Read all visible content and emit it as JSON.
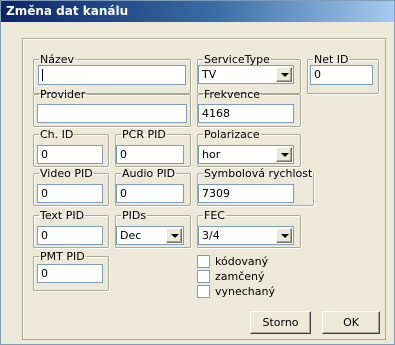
{
  "window": {
    "title": "Změna dat kanálu"
  },
  "fields": {
    "nazev": {
      "label": "Název",
      "value": ""
    },
    "service_type": {
      "label": "ServiceType",
      "value": "TV"
    },
    "net_id": {
      "label": "Net ID",
      "value": "0"
    },
    "provider": {
      "label": "Provider",
      "value": ""
    },
    "frekvence": {
      "label": "Frekvence",
      "value": "4168"
    },
    "ch_id": {
      "label": "Ch. ID",
      "value": "0"
    },
    "pcr_pid": {
      "label": "PCR PID",
      "value": "0"
    },
    "polarizace": {
      "label": "Polarizace",
      "value": "hor"
    },
    "video_pid": {
      "label": "Video PID",
      "value": "0"
    },
    "audio_pid": {
      "label": "Audio PID",
      "value": "0"
    },
    "symbolova_rychlost": {
      "label": "Symbolová rychlost",
      "value": "7309"
    },
    "text_pid": {
      "label": "Text PID",
      "value": "0"
    },
    "pids": {
      "label": "PIDs",
      "value": "Dec"
    },
    "fec": {
      "label": "FEC",
      "value": "3/4"
    },
    "pmt_pid": {
      "label": "PMT PID",
      "value": "0"
    }
  },
  "checkboxes": [
    {
      "label": "kódovaný",
      "checked": false
    },
    {
      "label": "zamčený",
      "checked": false
    },
    {
      "label": "vynechaný",
      "checked": false
    }
  ],
  "buttons": {
    "cancel": "Storno",
    "ok": "OK"
  },
  "colors": {
    "face": "#ece9d8",
    "titlebar_start": "#0a246a",
    "titlebar_end": "#a6caf0",
    "field_border": "#7f9db9"
  }
}
